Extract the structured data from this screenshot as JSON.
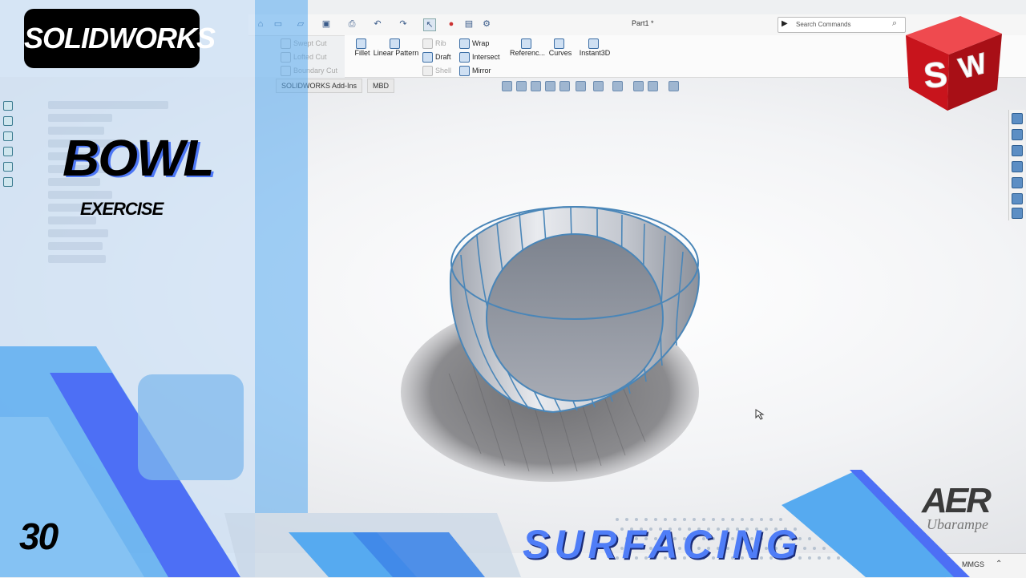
{
  "app": {
    "document_title": "Part1 *",
    "search_placeholder": "Search Commands",
    "ribbon": {
      "cut_items": [
        "Swept Cut",
        "Lofted Cut",
        "Boundary Cut"
      ],
      "fillet": "Fillet",
      "linear_pattern": "Linear Pattern",
      "rib": "Rib",
      "draft": "Draft",
      "shell": "Shell",
      "wrap": "Wrap",
      "intersect": "Intersect",
      "mirror": "Mirror",
      "reference": "Referenc...",
      "curves": "Curves",
      "instant3d": "Instant3D"
    },
    "tabs": [
      "SOLIDWORKS Add-Ins",
      "MBD"
    ],
    "units": "MMGS"
  },
  "overlay": {
    "brand": "SOLIDWORKS",
    "title": "BOWL",
    "subtitle": "EXERCISE",
    "episode": "30",
    "topic": "SURFACING",
    "cube_letters": "SW",
    "channel_logo": "AER",
    "channel_sub": "Ubarampe"
  },
  "colors": {
    "accent_blue": "#4f7df7",
    "light_blue": "#56aaf0",
    "panel_blue": "#cde1f5",
    "sw_red": "#d9262c",
    "bowl_edge": "#4a86b8"
  }
}
